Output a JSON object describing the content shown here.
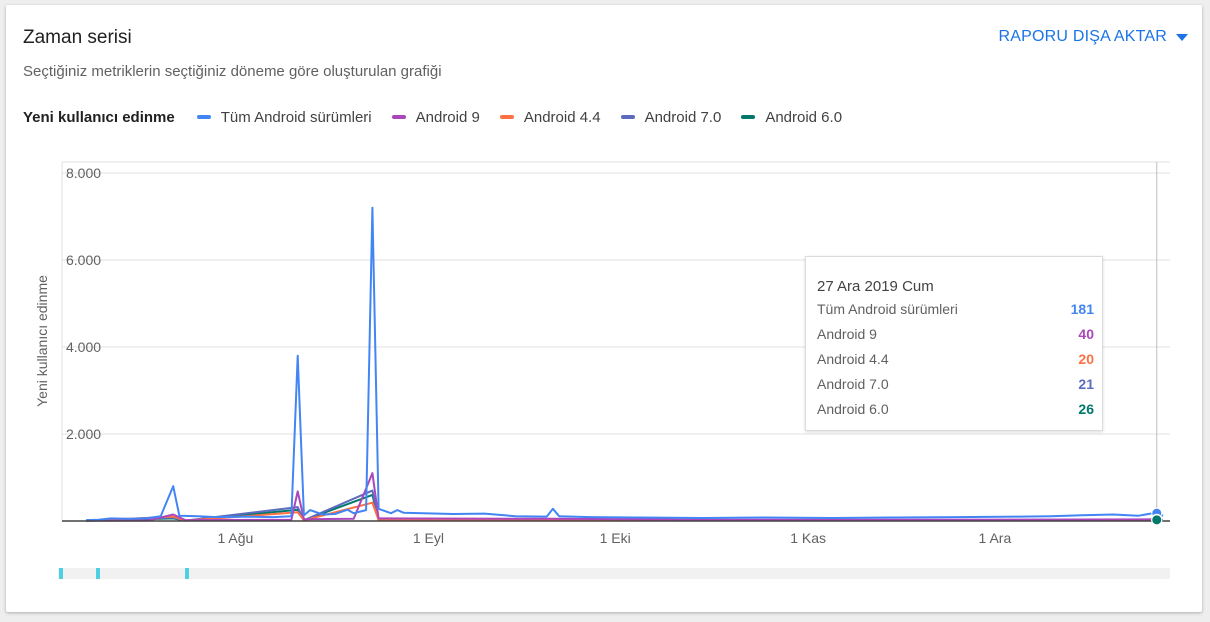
{
  "card": {
    "title": "Zaman serisi",
    "subtitle": "Seçtiğiniz metriklerin seçtiğiniz döneme göre oluşturulan grafiği",
    "export_label": "RAPORU DIŞA AKTAR",
    "legend_metric": "Yeni kullanıcı edinme"
  },
  "colors": {
    "accent": "#1a73e8",
    "grid": "#e0e0e0",
    "axis": "#616161"
  },
  "chart_data": {
    "type": "line",
    "ylabel": "Yeni kullanıcı edinme",
    "ylim": [
      0,
      8000
    ],
    "yticks": [
      {
        "value": 0,
        "label": ""
      },
      {
        "value": 2000,
        "label": "2.000"
      },
      {
        "value": 4000,
        "label": "4.000"
      },
      {
        "value": 6000,
        "label": "6.000"
      },
      {
        "value": 8000,
        "label": "8.000"
      }
    ],
    "x_start": "2019-07-08",
    "x_end": "2019-12-28",
    "xticks": [
      {
        "date": "2019-08-01",
        "label": "1 Ağu"
      },
      {
        "date": "2019-09-01",
        "label": "1 Eyl"
      },
      {
        "date": "2019-10-01",
        "label": "1 Eki"
      },
      {
        "date": "2019-11-01",
        "label": "1 Kas"
      },
      {
        "date": "2019-12-01",
        "label": "1 Ara"
      }
    ],
    "grid": true,
    "legend_position": "top-left",
    "series": [
      {
        "name": "Tüm Android sürümleri",
        "color": "#4285f4",
        "points": [
          [
            "2019-07-08",
            20
          ],
          [
            "2019-07-10",
            30
          ],
          [
            "2019-07-12",
            60
          ],
          [
            "2019-07-15",
            50
          ],
          [
            "2019-07-18",
            70
          ],
          [
            "2019-07-20",
            110
          ],
          [
            "2019-07-22",
            800
          ],
          [
            "2019-07-23",
            120
          ],
          [
            "2019-07-26",
            110
          ],
          [
            "2019-07-29",
            90
          ],
          [
            "2019-08-03",
            100
          ],
          [
            "2019-08-07",
            90
          ],
          [
            "2019-08-10",
            110
          ],
          [
            "2019-08-11",
            3800
          ],
          [
            "2019-08-12",
            130
          ],
          [
            "2019-08-13",
            250
          ],
          [
            "2019-08-15",
            150
          ],
          [
            "2019-08-17",
            160
          ],
          [
            "2019-08-19",
            260
          ],
          [
            "2019-08-20",
            180
          ],
          [
            "2019-08-22",
            250
          ],
          [
            "2019-08-23",
            7200
          ],
          [
            "2019-08-24",
            280
          ],
          [
            "2019-08-26",
            180
          ],
          [
            "2019-08-27",
            250
          ],
          [
            "2019-08-28",
            190
          ],
          [
            "2019-09-05",
            160
          ],
          [
            "2019-09-10",
            170
          ],
          [
            "2019-09-15",
            110
          ],
          [
            "2019-09-20",
            100
          ],
          [
            "2019-09-21",
            280
          ],
          [
            "2019-09-22",
            110
          ],
          [
            "2019-09-27",
            90
          ],
          [
            "2019-10-05",
            80
          ],
          [
            "2019-10-15",
            70
          ],
          [
            "2019-10-25",
            80
          ],
          [
            "2019-11-05",
            70
          ],
          [
            "2019-11-15",
            80
          ],
          [
            "2019-11-25",
            90
          ],
          [
            "2019-12-05",
            100
          ],
          [
            "2019-12-10",
            110
          ],
          [
            "2019-12-15",
            130
          ],
          [
            "2019-12-20",
            150
          ],
          [
            "2019-12-24",
            120
          ],
          [
            "2019-12-26",
            170
          ],
          [
            "2019-12-27",
            181
          ],
          [
            "2019-12-28",
            120
          ]
        ]
      },
      {
        "name": "Android 9",
        "color": "#ab47bc",
        "points": [
          [
            "2019-07-08",
            5
          ],
          [
            "2019-07-18",
            10
          ],
          [
            "2019-07-22",
            150
          ],
          [
            "2019-07-24",
            20
          ],
          [
            "2019-08-10",
            30
          ],
          [
            "2019-08-11",
            680
          ],
          [
            "2019-08-12",
            40
          ],
          [
            "2019-08-20",
            50
          ],
          [
            "2019-08-23",
            1100
          ],
          [
            "2019-08-24",
            60
          ],
          [
            "2019-09-21",
            50
          ],
          [
            "2019-10-15",
            30
          ],
          [
            "2019-11-15",
            30
          ],
          [
            "2019-12-15",
            35
          ],
          [
            "2019-12-27",
            40
          ],
          [
            "2019-12-28",
            30
          ]
        ]
      },
      {
        "name": "Android 4.4",
        "color": "#ff7043",
        "points": [
          [
            "2019-07-08",
            5
          ],
          [
            "2019-07-22",
            100
          ],
          [
            "2019-07-24",
            10
          ],
          [
            "2019-08-11",
            200
          ],
          [
            "2019-08-12",
            15
          ],
          [
            "2019-08-23",
            420
          ],
          [
            "2019-08-24",
            20
          ],
          [
            "2019-10-15",
            15
          ],
          [
            "2019-12-27",
            20
          ],
          [
            "2019-12-28",
            15
          ]
        ]
      },
      {
        "name": "Android 7.0",
        "color": "#5c6bc0",
        "points": [
          [
            "2019-07-08",
            5
          ],
          [
            "2019-07-22",
            80
          ],
          [
            "2019-07-24",
            10
          ],
          [
            "2019-08-11",
            320
          ],
          [
            "2019-08-12",
            15
          ],
          [
            "2019-08-23",
            700
          ],
          [
            "2019-08-24",
            20
          ],
          [
            "2019-10-15",
            15
          ],
          [
            "2019-12-27",
            21
          ],
          [
            "2019-12-28",
            15
          ]
        ]
      },
      {
        "name": "Android 6.0",
        "color": "#00796b",
        "points": [
          [
            "2019-07-08",
            5
          ],
          [
            "2019-07-22",
            60
          ],
          [
            "2019-07-24",
            10
          ],
          [
            "2019-08-11",
            260
          ],
          [
            "2019-08-12",
            15
          ],
          [
            "2019-08-23",
            600
          ],
          [
            "2019-08-24",
            20
          ],
          [
            "2019-10-15",
            15
          ],
          [
            "2019-12-27",
            26
          ],
          [
            "2019-12-28",
            15
          ]
        ]
      }
    ],
    "tooltip": {
      "date_label": "27 Ara 2019 Cum",
      "date": "2019-12-27",
      "rows": [
        {
          "name": "Tüm Android sürümleri",
          "value": "181",
          "color": "#4285f4"
        },
        {
          "name": "Android 9",
          "value": "40",
          "color": "#ab47bc"
        },
        {
          "name": "Android 4.4",
          "value": "20",
          "color": "#ff7043"
        },
        {
          "name": "Android 7.0",
          "value": "21",
          "color": "#5c6bc0"
        },
        {
          "name": "Android 6.0",
          "value": "26",
          "color": "#00796b"
        }
      ]
    }
  }
}
